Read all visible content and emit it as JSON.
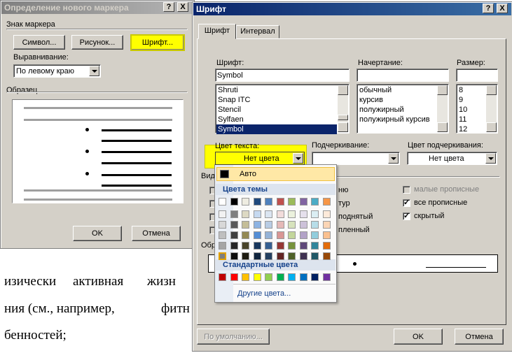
{
  "background_text": {
    "line1_words": [
      "изически",
      "активная",
      "жизн"
    ],
    "line2": "ния (см., например,",
    "line2_tail": "фитн",
    "line3": "бенностей;"
  },
  "marker_dialog": {
    "title": "Определение нового маркера",
    "help": "?",
    "close": "X",
    "marker_group": "Знак маркера",
    "symbol_button": "Символ...",
    "picture_button": "Рисунок...",
    "font_button": "Шрифт...",
    "alignment_label": "Выравнивание:",
    "alignment_value": "По левому краю",
    "sample_group": "Образец",
    "ok": "OK",
    "cancel": "Отмена"
  },
  "font_dialog": {
    "title": "Шрифт",
    "help": "?",
    "close": "X",
    "tabs": [
      "Шрифт",
      "Интервал"
    ],
    "font_label": "Шрифт:",
    "font_value": "Symbol",
    "font_list": [
      "Shruti",
      "Snap ITC",
      "Stencil",
      "Sylfaen",
      "Symbol"
    ],
    "style_label": "Начертание:",
    "style_value": "",
    "style_list": [
      "обычный",
      "курсив",
      "полужирный",
      "полужирный курсив"
    ],
    "size_label": "Размер:",
    "size_value": "",
    "size_list": [
      "8",
      "9",
      "10",
      "11",
      "12"
    ],
    "color_label": "Цвет текста:",
    "color_value": "Нет цвета",
    "underline_label": "Подчеркивание:",
    "underline_value": "",
    "underline_color_label": "Цвет подчеркивания:",
    "underline_color_value": "Нет цвета",
    "effects_label_fragment": "Вид",
    "sample_label_fragment": "Обр",
    "effects_partial": [
      "ню",
      "тур",
      "поднятый",
      "пленный"
    ],
    "small_caps": "малые прописные",
    "all_caps": "все прописные",
    "hidden": "скрытый",
    "default_button": "По умолчанию...",
    "ok": "OK",
    "cancel": "Отмена"
  },
  "color_popup": {
    "auto": "Авто",
    "theme_header": "Цвета темы",
    "standard_header": "Стандартные цвета",
    "more_colors": "Другие цвета...",
    "theme_top": [
      "#ffffff",
      "#000000",
      "#eeece1",
      "#1f497d",
      "#4f81bd",
      "#c0504d",
      "#9bbb59",
      "#8064a2",
      "#4bacc6",
      "#f79646"
    ],
    "theme_shades": [
      [
        "#f2f2f2",
        "#7f7f7f",
        "#ddd9c3",
        "#c6d9f0",
        "#dbe5f1",
        "#f2dcdb",
        "#ebf1dd",
        "#e5e0ec",
        "#dbeef3",
        "#fdeada"
      ],
      [
        "#d8d8d8",
        "#595959",
        "#c4bd97",
        "#8db3e2",
        "#b8cce4",
        "#e5b9b7",
        "#d7e3bc",
        "#ccc1d9",
        "#b7dde8",
        "#fbd5b5"
      ],
      [
        "#bfbfbf",
        "#3f3f3f",
        "#938953",
        "#548dd4",
        "#95b3d7",
        "#d99694",
        "#c3d69b",
        "#b2a2c7",
        "#92cddc",
        "#fac08f"
      ],
      [
        "#a5a5a5",
        "#262626",
        "#494429",
        "#17365d",
        "#366092",
        "#953734",
        "#76923c",
        "#5f497a",
        "#31859b",
        "#e36c09"
      ],
      [
        "#7f7f7f",
        "#0c0c0c",
        "#1d1b10",
        "#0f243e",
        "#244061",
        "#632423",
        "#4f6128",
        "#3f3151",
        "#205867",
        "#974806"
      ]
    ],
    "standard": [
      "#c00000",
      "#ff0000",
      "#ffc000",
      "#ffff00",
      "#92d050",
      "#00b050",
      "#00b0f0",
      "#0070c0",
      "#002060",
      "#7030a0"
    ]
  }
}
